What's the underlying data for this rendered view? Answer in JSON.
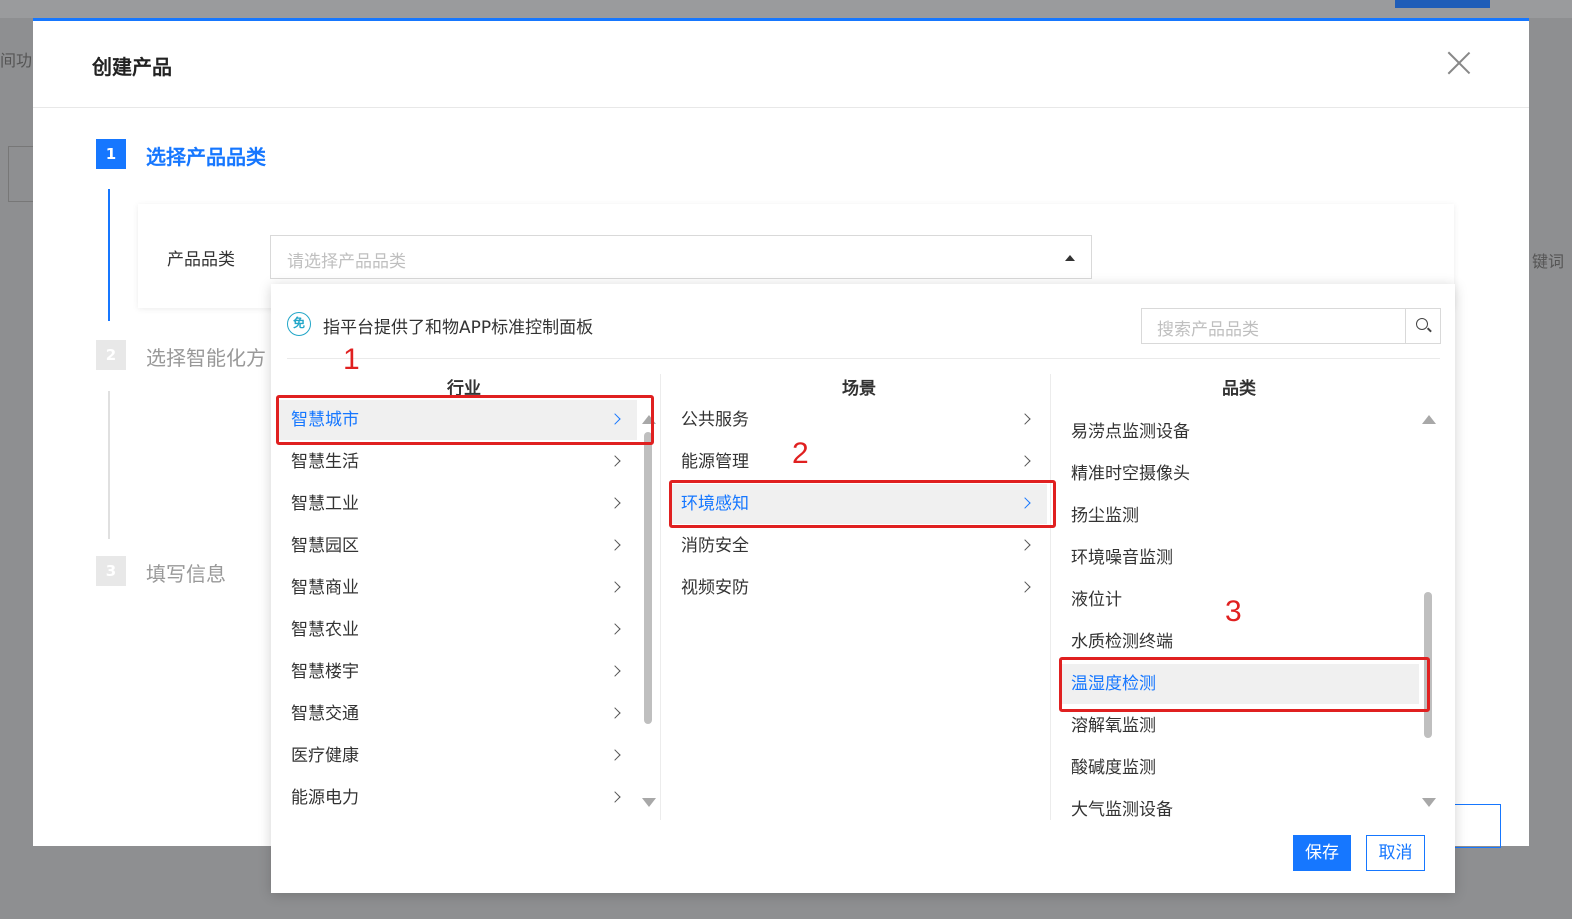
{
  "background": {
    "left_text": "间功能",
    "right_text": "键词"
  },
  "modal": {
    "title": "创建产品",
    "steps": [
      {
        "num": "1",
        "label": "选择产品品类"
      },
      {
        "num": "2",
        "label": "选择智能化方"
      },
      {
        "num": "3",
        "label": "填写信息"
      }
    ],
    "field_label": "产品品类",
    "select_placeholder": "请选择产品品类"
  },
  "dropdown": {
    "free_badge": "免",
    "free_text": "指平台提供了和物APP标准控制面板",
    "search_placeholder": "搜索产品品类",
    "columns": {
      "industry": {
        "title": "行业",
        "items": [
          "智慧城市",
          "智慧生活",
          "智慧工业",
          "智慧园区",
          "智慧商业",
          "智慧农业",
          "智慧楼宇",
          "智慧交通",
          "医疗健康",
          "能源电力"
        ],
        "selected": "智慧城市"
      },
      "scene": {
        "title": "场景",
        "items": [
          "公共服务",
          "能源管理",
          "环境感知",
          "消防安全",
          "视频安防"
        ],
        "selected": "环境感知"
      },
      "category": {
        "title": "品类",
        "items": [
          "易涝点监测设备",
          "精准时空摄像头",
          "扬尘监测",
          "环境噪音监测",
          "液位计",
          "水质检测终端",
          "温湿度检测",
          "溶解氧监测",
          "酸碱度监测",
          "大气监测设备"
        ],
        "selected": "温湿度检测"
      }
    },
    "save_label": "保存",
    "cancel_label": "取消"
  },
  "annotations": [
    "1",
    "2",
    "3"
  ],
  "colors": {
    "accent": "#1677ff",
    "annotation": "#e02020"
  }
}
